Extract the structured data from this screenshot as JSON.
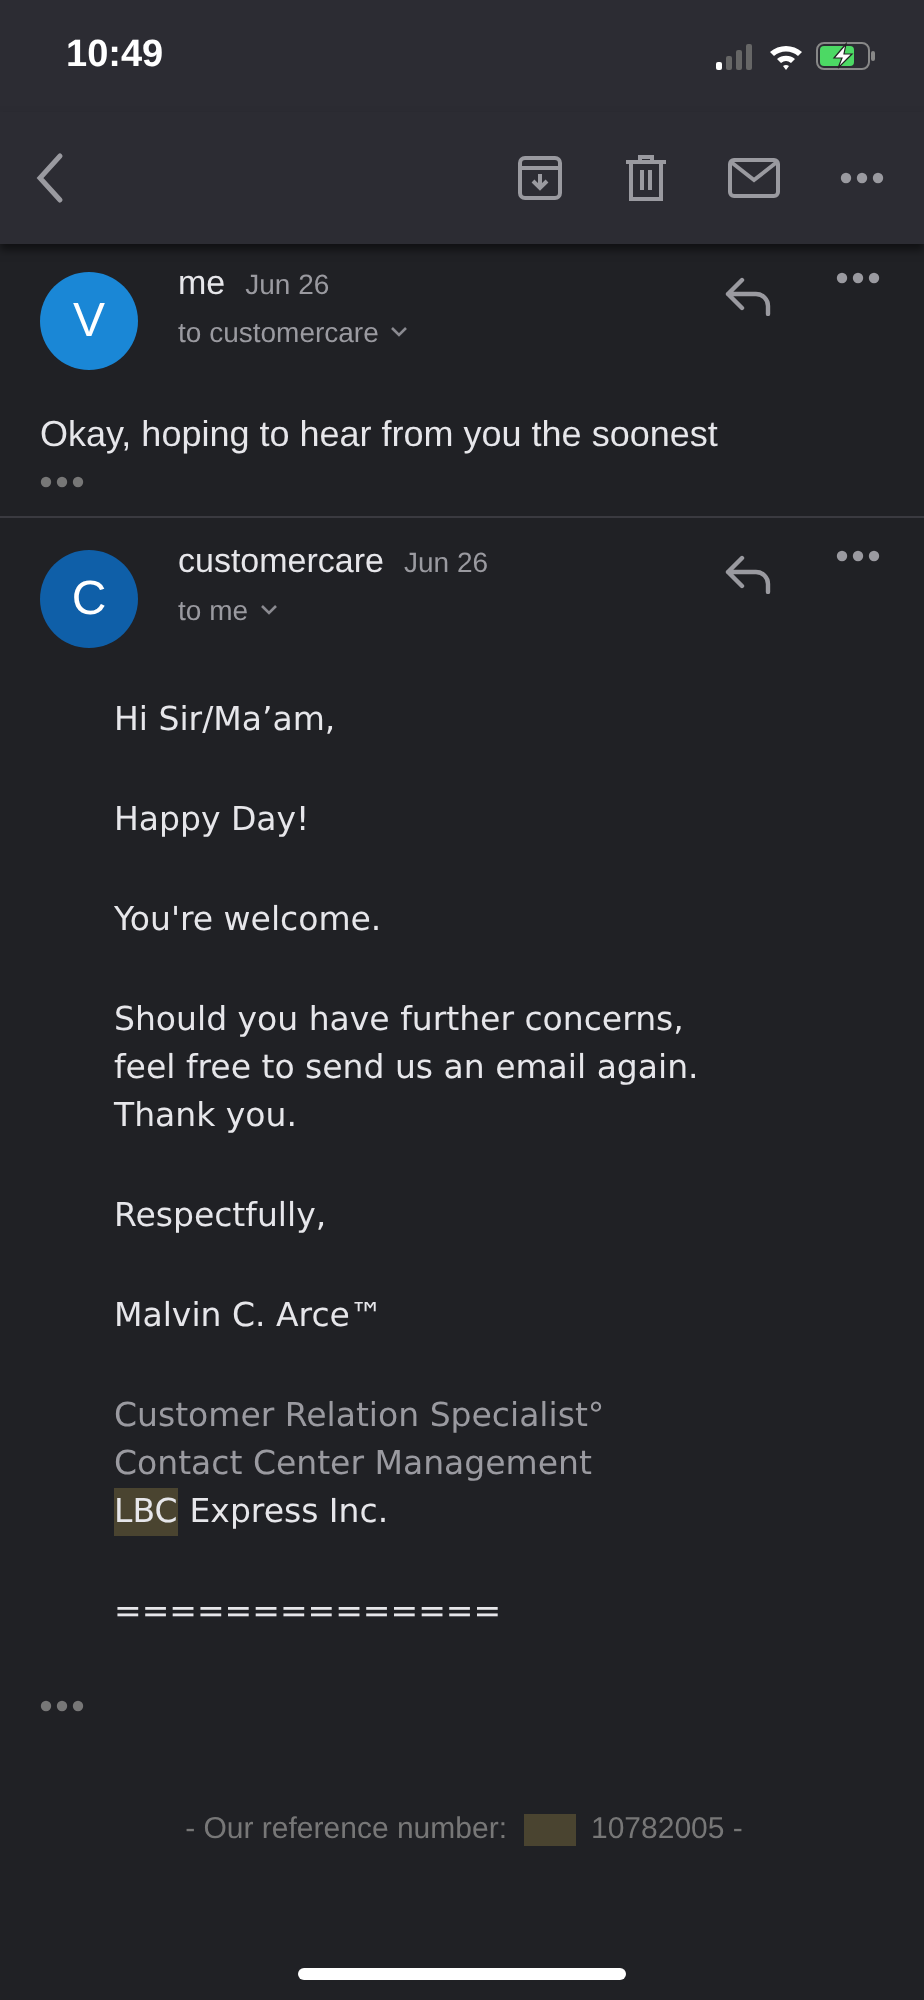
{
  "status_bar": {
    "time": "10:49"
  },
  "messages": [
    {
      "avatar_letter": "V",
      "sender": "me",
      "date": "Jun 26",
      "recipient": "to customercare",
      "body": "Okay, hoping to hear from you the soonest"
    },
    {
      "avatar_letter": "C",
      "sender": "customercare",
      "date": "Jun 26",
      "recipient": "to me",
      "paragraphs": [
        {
          "kind": "plain",
          "lines": [
            "Hi Sir/Ma’am,"
          ]
        },
        {
          "kind": "plain",
          "lines": [
            "Happy Day!"
          ]
        },
        {
          "kind": "plain",
          "lines": [
            "You're welcome."
          ]
        },
        {
          "kind": "plain",
          "lines": [
            "Should you have further concerns,",
            "feel free to send us an email again.",
            "Thank you."
          ]
        },
        {
          "kind": "plain",
          "lines": [
            "Respectfully,"
          ]
        },
        {
          "kind": "plain",
          "lines": [
            "Malvin C. Arce™"
          ]
        },
        {
          "kind": "signature",
          "lines": [
            "Customer Relation Specialist°",
            "Contact Center Management"
          ],
          "company": [
            {
              "text": "LBC",
              "highlighted": true
            },
            {
              "text": "Express Inc.",
              "highlighted": false
            }
          ]
        },
        {
          "kind": "plain",
          "lines": [
            "=============="
          ]
        }
      ],
      "reference": {
        "label": "- Our reference number:",
        "number": "10782005 -"
      }
    }
  ]
}
